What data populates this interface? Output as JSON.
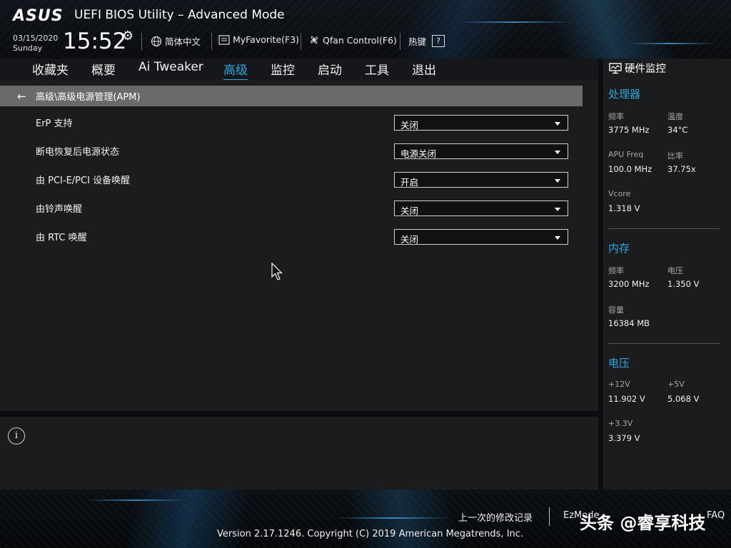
{
  "header": {
    "logo": "/ISUS",
    "title": "UEFI BIOS Utility – Advanced Mode",
    "date": "03/15/2020",
    "weekday": "Sunday",
    "time": "15:52",
    "language_label": "简体中文",
    "myfavorite_label": "MyFavorite(F3)",
    "qfan_label": "Qfan Control(F6)",
    "hotkey_label": "热键",
    "hotkey_box": "?"
  },
  "tabs": [
    {
      "label": "收藏夹",
      "active": false
    },
    {
      "label": "概要",
      "active": false
    },
    {
      "label": "Ai Tweaker",
      "active": false
    },
    {
      "label": "高级",
      "active": true
    },
    {
      "label": "监控",
      "active": false
    },
    {
      "label": "启动",
      "active": false
    },
    {
      "label": "工具",
      "active": false
    },
    {
      "label": "退出",
      "active": false
    }
  ],
  "breadcrumb": "高级\\高级电源管理(APM)",
  "settings": [
    {
      "label": "ErP 支持",
      "value": "关闭"
    },
    {
      "label": "断电恢复后电源状态",
      "value": "电源关闭"
    },
    {
      "label": "由 PCI-E/PCI 设备唤醒",
      "value": "开启"
    },
    {
      "label": "由铃声唤醒",
      "value": "关闭"
    },
    {
      "label": "由 RTC 唤醒",
      "value": "关闭"
    }
  ],
  "help_icon": "i",
  "monitor": {
    "title": "硬件监控",
    "cpu": {
      "heading": "处理器",
      "freq_label": "频率",
      "freq": "3775 MHz",
      "temp_label": "温度",
      "temp": "34°C",
      "apu_label": "APU Freq",
      "apu": "100.0 MHz",
      "ratio_label": "比率",
      "ratio": "37.75x",
      "vcore_label": "Vcore",
      "vcore": "1.318 V"
    },
    "memory": {
      "heading": "内存",
      "freq_label": "频率",
      "freq": "3200 MHz",
      "volt_label": "电压",
      "volt": "1.350 V",
      "cap_label": "容量",
      "cap": "16384 MB"
    },
    "voltage": {
      "heading": "电压",
      "v12_label": "+12V",
      "v12": "11.902 V",
      "v5_label": "+5V",
      "v5": "5.068 V",
      "v33_label": "+3.3V",
      "v33": "3.379 V"
    }
  },
  "footer": {
    "last_modified": "上一次的修改记录",
    "ezmode": "EzMode",
    "faq": "FAQ",
    "version": "Version 2.17.1246. Copyright (C) 2019 American Megatrends, Inc.",
    "watermark": "头条 @睿享科技"
  },
  "colors": {
    "accent": "#27a9e1",
    "panel": "#1b1c1e",
    "breadcrumb": "#6a6a6a"
  }
}
